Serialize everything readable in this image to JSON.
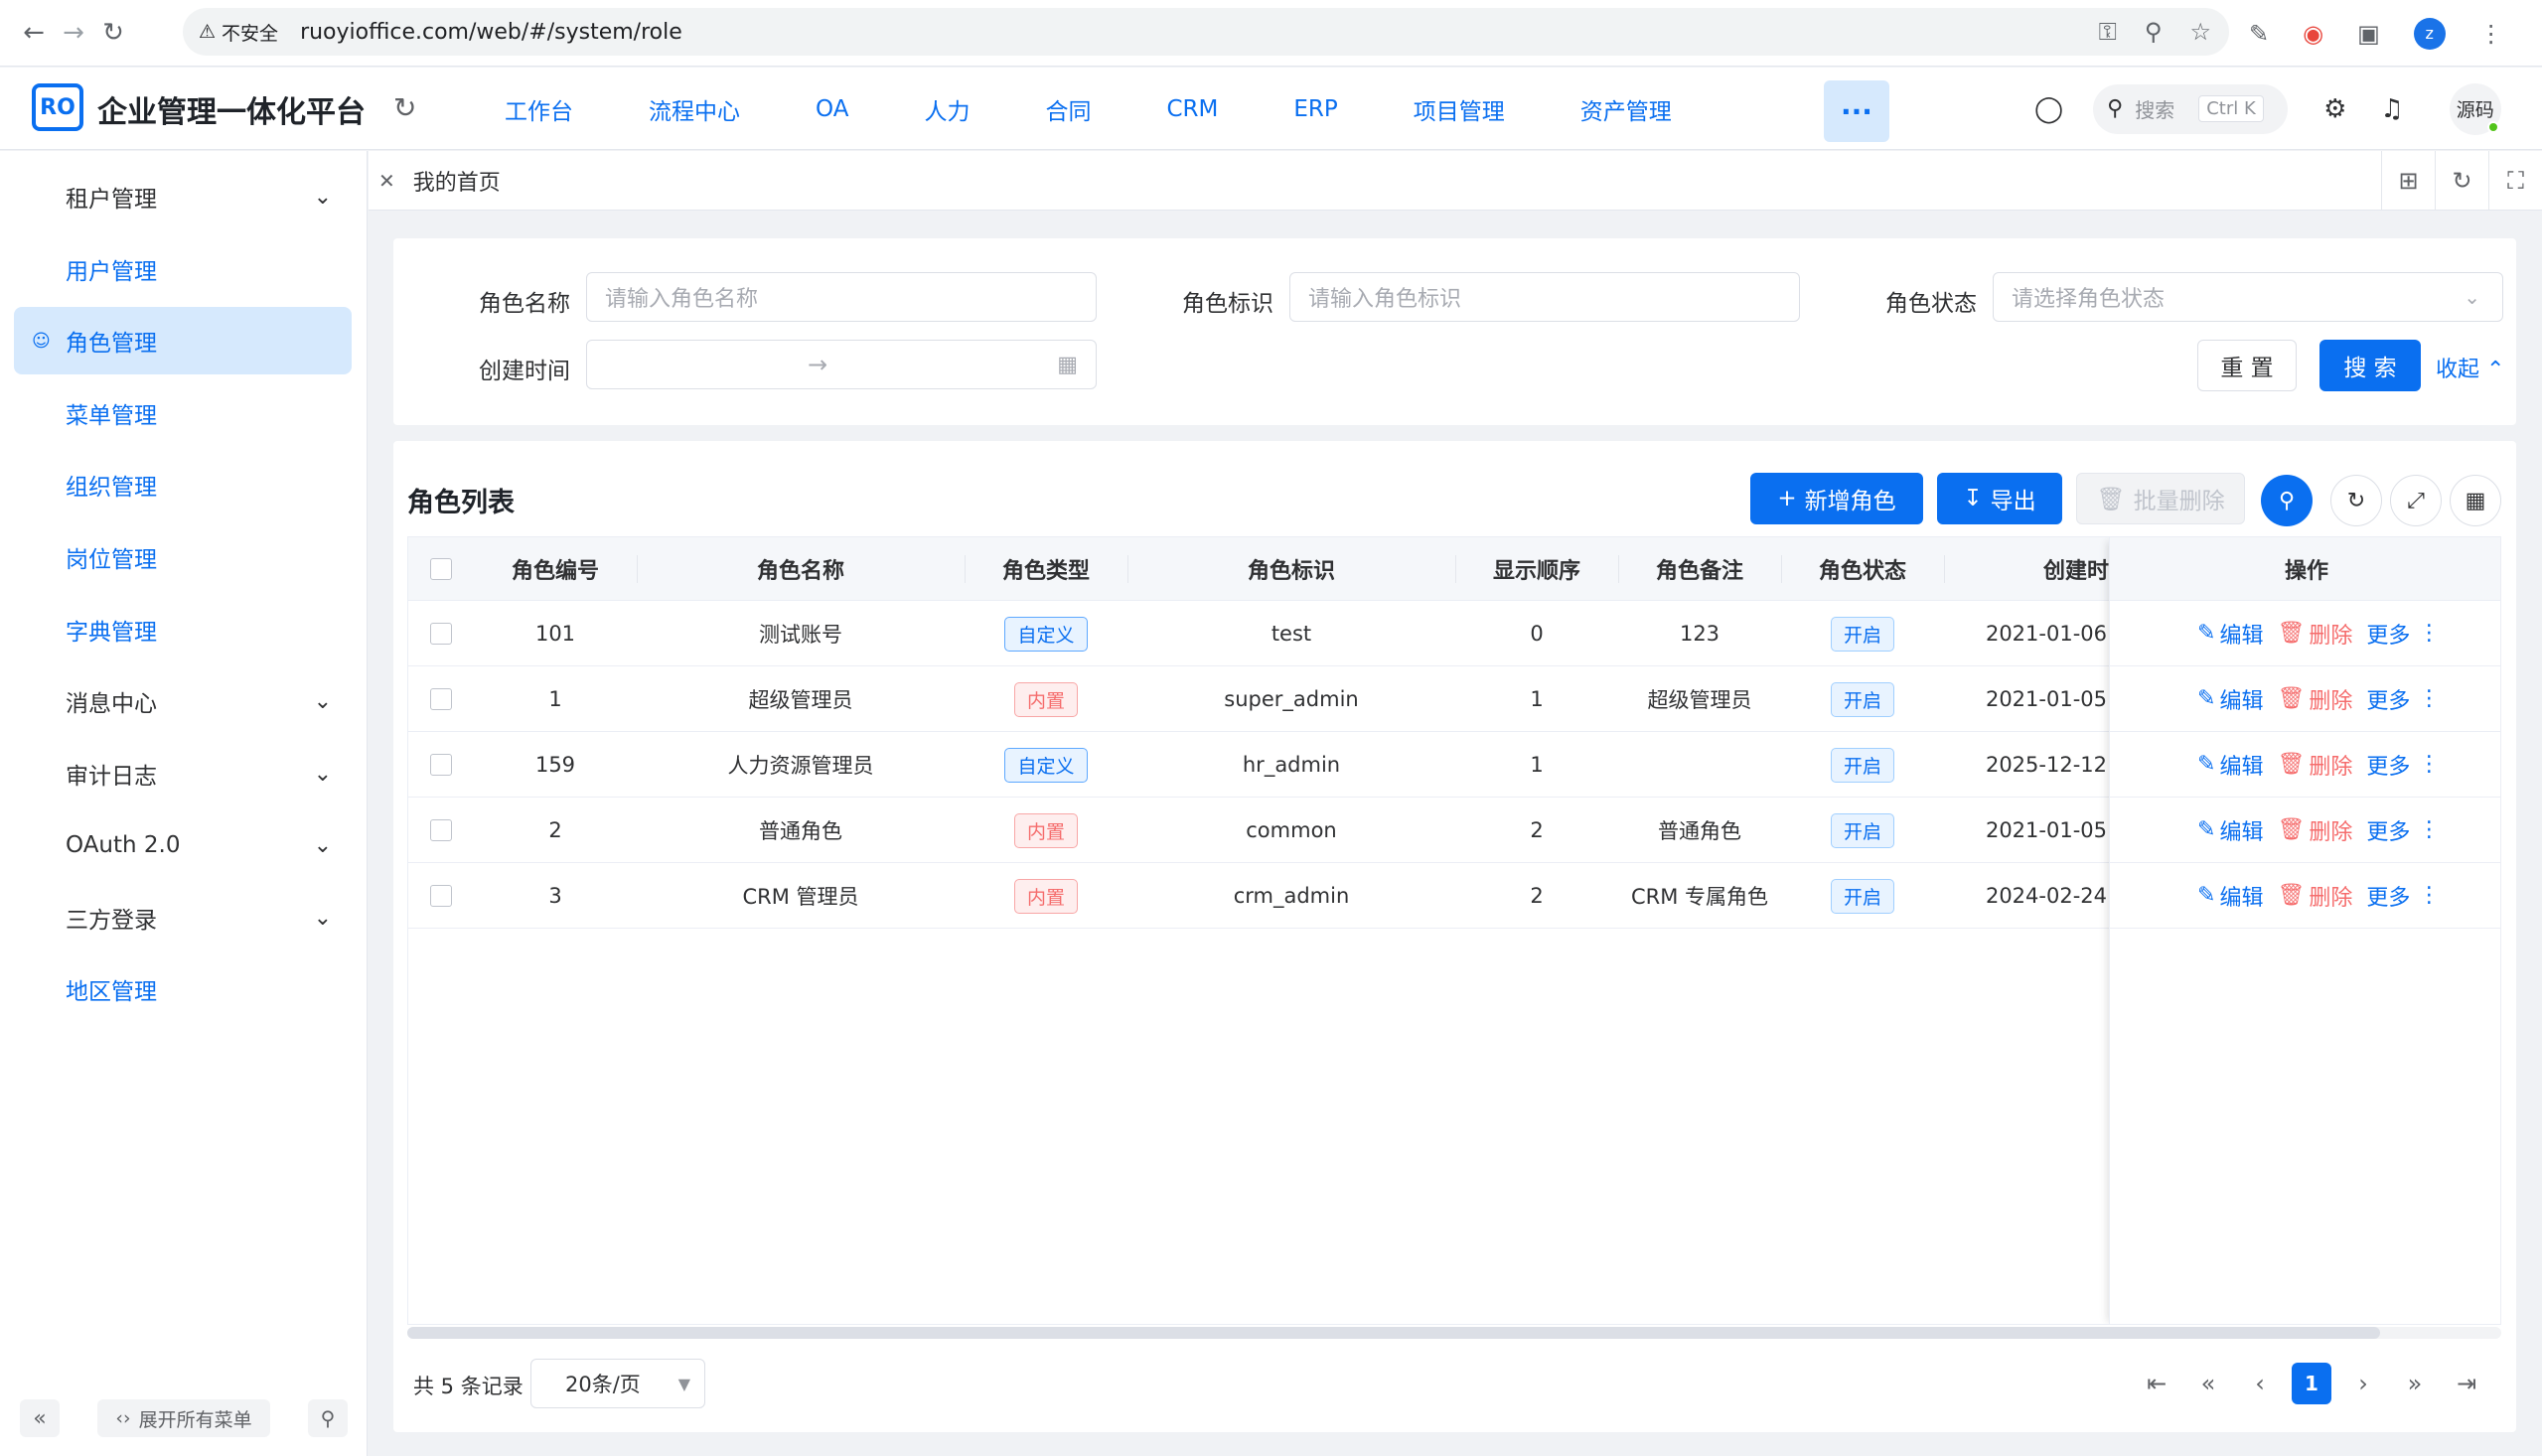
{
  "browser": {
    "insecure_label": "不安全",
    "url": "ruoyioffice.com/web/#/system/role",
    "profile_letter": "z"
  },
  "header": {
    "logo_text": "RO",
    "title": "企业管理一体化平台",
    "menu": [
      "工作台",
      "流程中心",
      "OA",
      "人力",
      "合同",
      "CRM",
      "ERP",
      "项目管理",
      "资产管理"
    ],
    "more": "···",
    "search_placeholder": "搜索",
    "search_shortcut": "Ctrl K",
    "avatar_text": "源码"
  },
  "sidebar": {
    "items": [
      {
        "label": "租户管理",
        "expandable": true
      },
      {
        "label": "用户管理",
        "expandable": false
      },
      {
        "label": "角色管理",
        "expandable": false,
        "active": true
      },
      {
        "label": "菜单管理",
        "expandable": false
      },
      {
        "label": "组织管理",
        "expandable": false
      },
      {
        "label": "岗位管理",
        "expandable": false
      },
      {
        "label": "字典管理",
        "expandable": false
      },
      {
        "label": "消息中心",
        "expandable": true
      },
      {
        "label": "审计日志",
        "expandable": true
      },
      {
        "label": "OAuth 2.0",
        "expandable": true
      },
      {
        "label": "三方登录",
        "expandable": true
      },
      {
        "label": "地区管理",
        "expandable": false
      }
    ],
    "expand_all": "展开所有菜单"
  },
  "tabs": {
    "current": "我的首页"
  },
  "search_form": {
    "role_name_label": "角色名称",
    "role_name_placeholder": "请输入角色名称",
    "role_key_label": "角色标识",
    "role_key_placeholder": "请输入角色标识",
    "role_status_label": "角色状态",
    "role_status_placeholder": "请选择角色状态",
    "create_time_label": "创建时间",
    "reset": "重 置",
    "search": "搜 索",
    "collapse": "收起"
  },
  "table": {
    "title": "角色列表",
    "add_button": "新增角色",
    "export_button": "导出",
    "batch_delete_button": "批量删除",
    "columns": [
      "角色编号",
      "角色名称",
      "角色类型",
      "角色标识",
      "显示顺序",
      "角色备注",
      "角色状态",
      "创建时",
      "操作"
    ],
    "rows": [
      {
        "id": "101",
        "name": "测试账号",
        "type": "自定义",
        "type_kind": "custom",
        "key": "test",
        "sort": "0",
        "remark": "123",
        "status": "开启",
        "created": "2021-01-06"
      },
      {
        "id": "1",
        "name": "超级管理员",
        "type": "内置",
        "type_kind": "builtin",
        "key": "super_admin",
        "sort": "1",
        "remark": "超级管理员",
        "status": "开启",
        "created": "2021-01-05"
      },
      {
        "id": "159",
        "name": "人力资源管理员",
        "type": "自定义",
        "type_kind": "custom",
        "key": "hr_admin",
        "sort": "1",
        "remark": "",
        "status": "开启",
        "created": "2025-12-12"
      },
      {
        "id": "2",
        "name": "普通角色",
        "type": "内置",
        "type_kind": "builtin",
        "key": "common",
        "sort": "2",
        "remark": "普通角色",
        "status": "开启",
        "created": "2021-01-05"
      },
      {
        "id": "3",
        "name": "CRM 管理员",
        "type": "内置",
        "type_kind": "builtin",
        "key": "crm_admin",
        "sort": "2",
        "remark": "CRM 专属角色",
        "status": "开启",
        "created": "2024-02-24"
      }
    ],
    "actions": {
      "edit": "编辑",
      "delete": "删除",
      "more": "更多"
    }
  },
  "pagination": {
    "total": "共 5 条记录",
    "page_size": "20条/页",
    "current_page": "1"
  }
}
